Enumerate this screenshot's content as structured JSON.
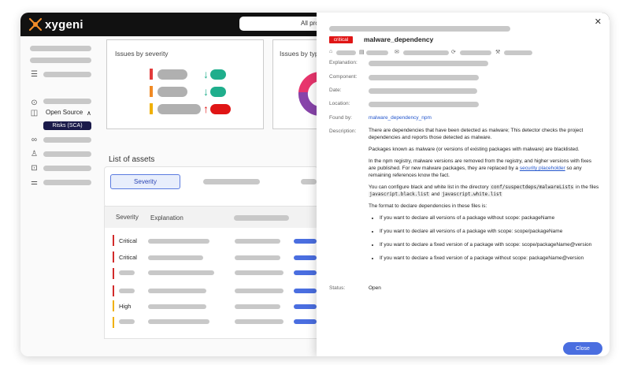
{
  "app": {
    "brand": "xygeni",
    "top_search_text": "All pro"
  },
  "sidebar": {
    "open_source_label": "Open Source",
    "risks_badge": "Risks (SCA)"
  },
  "main": {
    "issues_by_severity_title": "Issues by severity",
    "issues_by_type_title": "Issues by typ",
    "list_of_assets_title": "List of assets",
    "severity_tab": "Severity",
    "table_headers": {
      "severity": "Severity",
      "explanation": "Explanation"
    },
    "rows": [
      {
        "label": "Critical",
        "color": "#d22b2b"
      },
      {
        "label": "Critical",
        "color": "#d22b2b"
      },
      {
        "label": "",
        "color": "#d22b2b"
      },
      {
        "label": "",
        "color": "#d22b2b"
      },
      {
        "label": "High",
        "color": "#f0b000"
      },
      {
        "label": "",
        "color": "#f0b000"
      }
    ]
  },
  "panel": {
    "badge": "critical",
    "title": "malware_dependency",
    "labels": {
      "explanation": "Explanation:",
      "component": "Component:",
      "date": "Date:",
      "location": "Location:",
      "found_by": "Found by:",
      "description": "Description:",
      "status": "Status:"
    },
    "found_by_value": "malware_dependency_npm",
    "description": {
      "p1": "There are dependencies that have been detected as malware; This detector checks the project dependencies and reports those detected as malware.",
      "p2": "Packages known as malware (or versions of existing packages with malware) are blacklisted.",
      "p3_before": "In the npm registry, malware versions are removed from the registry, and higher versions with fixes are published. For new malware packages, they are replaced by a ",
      "p3_link": "security placeholder",
      "p3_after": " so any remaining references know the fact.",
      "p4_before": "You can configure black and white list in the directory ",
      "p4_code1": "conf/suspectdeps/malwareLists",
      "p4_mid": " in the files ",
      "p4_code2": "javascript.black.list",
      "p4_and": " and ",
      "p4_code3": "javascript.white.list",
      "p5": "The format to declare dependencies in these files is:",
      "bullets": [
        "If you want to declare all versions of a package without scope: packageName",
        "If you want to declare all versions of a package with scope: scope/packageName",
        "If you want to declare a fixed version of a package with scope: scope/packageName@version",
        "If you want to declare a fixed version of a package without scope: packageName@version"
      ]
    },
    "status_value": "Open",
    "close_button": "Close"
  },
  "colors": {
    "critical": "#e01515",
    "accent": "#4a6ee0",
    "high": "#f0b000",
    "green": "#1fae8c"
  }
}
